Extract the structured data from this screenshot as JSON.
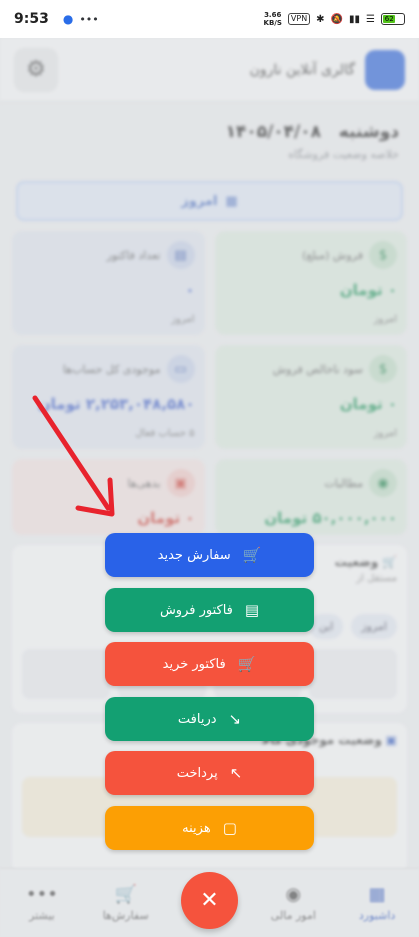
{
  "status_bar": {
    "time": "9:53",
    "net_speed": "3.66",
    "net_unit": "KB/S",
    "vpn": "VPN",
    "battery": "62"
  },
  "header": {
    "brand": "گالری آنلاین نارون"
  },
  "summary": {
    "day": "دوشنبه",
    "date": "۱۴۰۵/۰۴/۰۸",
    "subtitle": "خلاصه وضعیت فروشگاه",
    "period_button": "امروز"
  },
  "cards": [
    {
      "label": "فروش (مبلغ)",
      "value": "۰ تومان",
      "foot": "امروز",
      "icon": "dollar-icon"
    },
    {
      "label": "تعداد فاکتور",
      "value": "۰",
      "foot": "امروز",
      "icon": "receipt-icon"
    },
    {
      "label": "سود ناخالص فروش",
      "value": "۰ تومان",
      "foot": "امروز",
      "icon": "dollar-icon"
    },
    {
      "label": "موجودی کل حساب‌ها",
      "value": "۲,۲۵۳,۰۴۸,۵۸۰ تومان",
      "foot": "۵ حساب فعال",
      "icon": "card-icon"
    },
    {
      "label": "مطالبات",
      "value": "۵۰,۰۰۰,۰۰۰ تومان",
      "foot": "",
      "icon": "handshake-icon"
    },
    {
      "label": "بدهی‌ها",
      "value": "۰ تومان",
      "foot": "",
      "icon": "money-icon"
    }
  ],
  "orders_panel": {
    "title": "وضعیت",
    "subtitle": "مستقل از",
    "chips": [
      "امروز",
      "این",
      ""
    ]
  },
  "stock_panel": {
    "title": "وضعیت موجودی کالا"
  },
  "speed_dial": [
    {
      "label": "سفارش جدید",
      "icon": "cart-icon"
    },
    {
      "label": "فاکتور فروش",
      "icon": "register-icon"
    },
    {
      "label": "فاکتور خرید",
      "icon": "cart-icon"
    },
    {
      "label": "دریافت",
      "icon": "arrow-down-right-icon"
    },
    {
      "label": "پرداخت",
      "icon": "arrow-up-left-icon"
    },
    {
      "label": "هزینه",
      "icon": "invoice-dollar-icon"
    }
  ],
  "bottom_nav": [
    {
      "label": "داشبورد",
      "icon": "dashboard-icon",
      "active": true
    },
    {
      "label": "امور مالی",
      "icon": "coin-icon",
      "active": false
    },
    {
      "label": "سفارش‌ها",
      "icon": "cart-icon",
      "active": false
    },
    {
      "label": "بیشتر",
      "icon": "more-icon",
      "active": false
    }
  ],
  "colors": {
    "blue": "#2962e8",
    "green": "#13a072",
    "red": "#f5533d",
    "orange": "#fc9f04"
  }
}
